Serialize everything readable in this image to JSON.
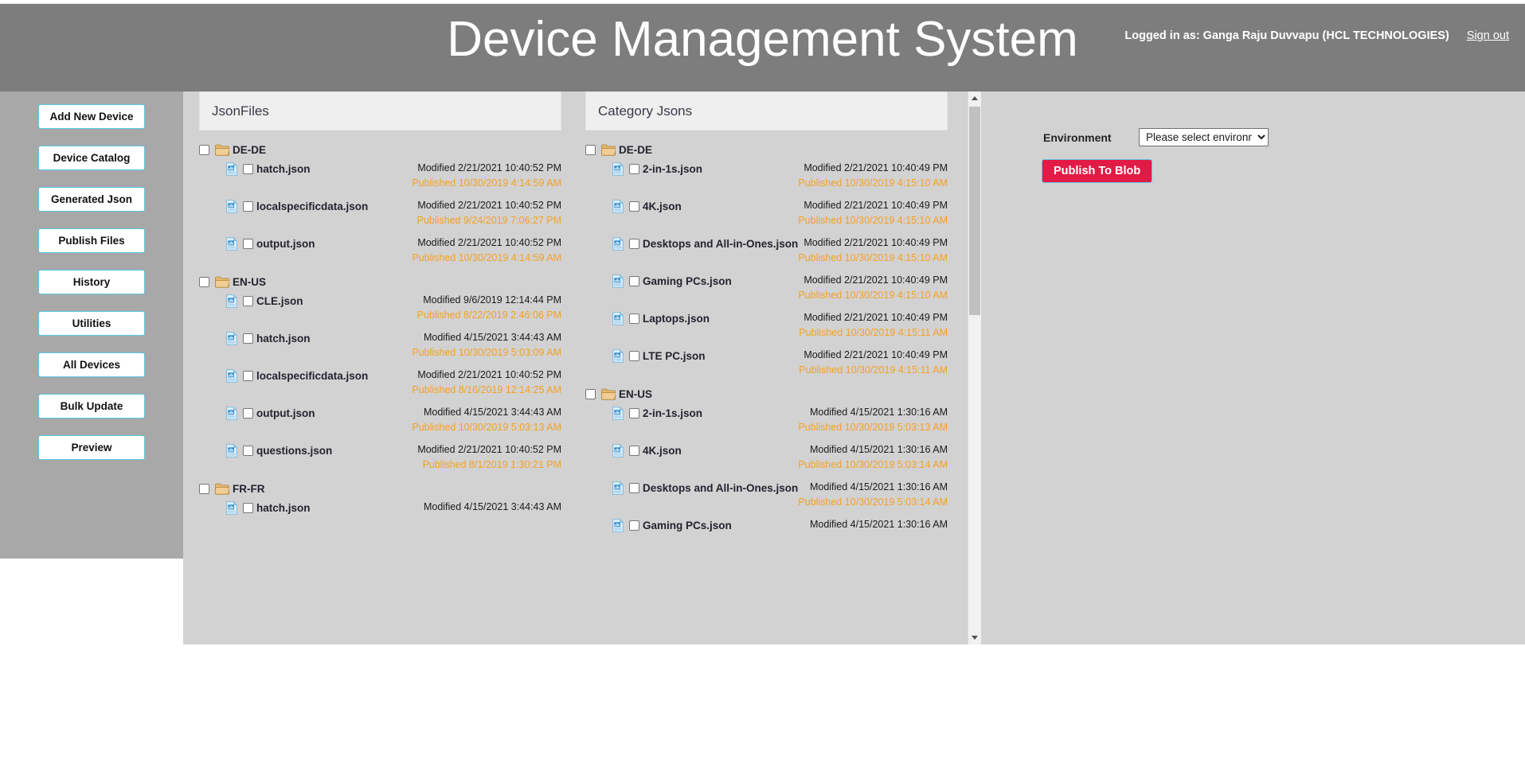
{
  "header": {
    "title": "Device Management System",
    "logged_in_text": "Logged in as: Ganga Raju Duvvapu (HCL TECHNOLOGIES)",
    "sign_out_label": "Sign out",
    "background_color": "#7d7d7d"
  },
  "sidebar": {
    "background_color": "#a8a8a8",
    "items": [
      {
        "label": "Add New Device",
        "name": "add-new-device"
      },
      {
        "label": "Device Catalog",
        "name": "device-catalog"
      },
      {
        "label": "Generated Json",
        "name": "generated-json"
      },
      {
        "label": "Publish Files",
        "name": "publish-files"
      },
      {
        "label": "History",
        "name": "history"
      },
      {
        "label": "Utilities",
        "name": "utilities"
      },
      {
        "label": "All Devices",
        "name": "all-devices"
      },
      {
        "label": "Bulk Update",
        "name": "bulk-update"
      },
      {
        "label": "Preview",
        "name": "preview"
      }
    ]
  },
  "panels": {
    "json_files": {
      "title": "JsonFiles",
      "groups": [
        {
          "folder": "DE-DE",
          "files": [
            {
              "name": "hatch.json",
              "modified": "Modified 2/21/2021 10:40:52 PM",
              "published": "Published 10/30/2019 4:14:59 AM"
            },
            {
              "name": "localspecificdata.json",
              "modified": "Modified 2/21/2021 10:40:52 PM",
              "published": "Published 9/24/2019 7:06:27 PM"
            },
            {
              "name": "output.json",
              "modified": "Modified 2/21/2021 10:40:52 PM",
              "published": "Published 10/30/2019 4:14:59 AM"
            }
          ]
        },
        {
          "folder": "EN-US",
          "files": [
            {
              "name": "CLE.json",
              "modified": "Modified 9/6/2019 12:14:44 PM",
              "published": "Published 8/22/2019 2:46:06 PM"
            },
            {
              "name": "hatch.json",
              "modified": "Modified 4/15/2021 3:44:43 AM",
              "published": "Published 10/30/2019 5:03:09 AM"
            },
            {
              "name": "localspecificdata.json",
              "modified": "Modified 2/21/2021 10:40:52 PM",
              "published": "Published 8/16/2019 12:14:25 AM"
            },
            {
              "name": "output.json",
              "modified": "Modified 4/15/2021 3:44:43 AM",
              "published": "Published 10/30/2019 5:03:13 AM"
            },
            {
              "name": "questions.json",
              "modified": "Modified 2/21/2021 10:40:52 PM",
              "published": "Published 8/1/2019 1:30:21 PM"
            }
          ]
        },
        {
          "folder": "FR-FR",
          "files": [
            {
              "name": "hatch.json",
              "modified": "Modified 4/15/2021 3:44:43 AM",
              "published": ""
            }
          ]
        }
      ]
    },
    "category_jsons": {
      "title": "Category Jsons",
      "groups": [
        {
          "folder": "DE-DE",
          "files": [
            {
              "name": "2-in-1s.json",
              "modified": "Modified 2/21/2021 10:40:49 PM",
              "published": "Published 10/30/2019 4:15:10 AM"
            },
            {
              "name": "4K.json",
              "modified": "Modified 2/21/2021 10:40:49 PM",
              "published": "Published 10/30/2019 4:15:10 AM"
            },
            {
              "name": "Desktops and All-in-Ones.json",
              "modified": "Modified 2/21/2021 10:40:49 PM",
              "published": "Published 10/30/2019 4:15:10 AM"
            },
            {
              "name": "Gaming PCs.json",
              "modified": "Modified 2/21/2021 10:40:49 PM",
              "published": "Published 10/30/2019 4:15:10 AM"
            },
            {
              "name": "Laptops.json",
              "modified": "Modified 2/21/2021 10:40:49 PM",
              "published": "Published 10/30/2019 4:15:11 AM"
            },
            {
              "name": "LTE PC.json",
              "modified": "Modified 2/21/2021 10:40:49 PM",
              "published": "Published 10/30/2019 4:15:11 AM"
            }
          ]
        },
        {
          "folder": "EN-US",
          "files": [
            {
              "name": "2-in-1s.json",
              "modified": "Modified 4/15/2021 1:30:16 AM",
              "published": "Published 10/30/2019 5:03:13 AM"
            },
            {
              "name": "4K.json",
              "modified": "Modified 4/15/2021 1:30:16 AM",
              "published": "Published 10/30/2019 5:03:14 AM"
            },
            {
              "name": "Desktops and All-in-Ones.json",
              "modified": "Modified 4/15/2021 1:30:16 AM",
              "published": "Published 10/30/2019 5:03:14 AM"
            },
            {
              "name": "Gaming PCs.json",
              "modified": "Modified 4/15/2021 1:30:16 AM",
              "published": ""
            }
          ]
        }
      ]
    }
  },
  "environment": {
    "label": "Environment",
    "selected_option": "Please select environment",
    "options": [
      "Please select environment"
    ],
    "publish_button_label": "Publish To Blob",
    "publish_button_color": "#e11b46"
  },
  "colors": {
    "published_text": "#f5a025",
    "modified_text": "#1a1a1a",
    "content_background": "#d2d2d2",
    "panel_header": "#efefef",
    "button_border": "#5bc8ea"
  }
}
